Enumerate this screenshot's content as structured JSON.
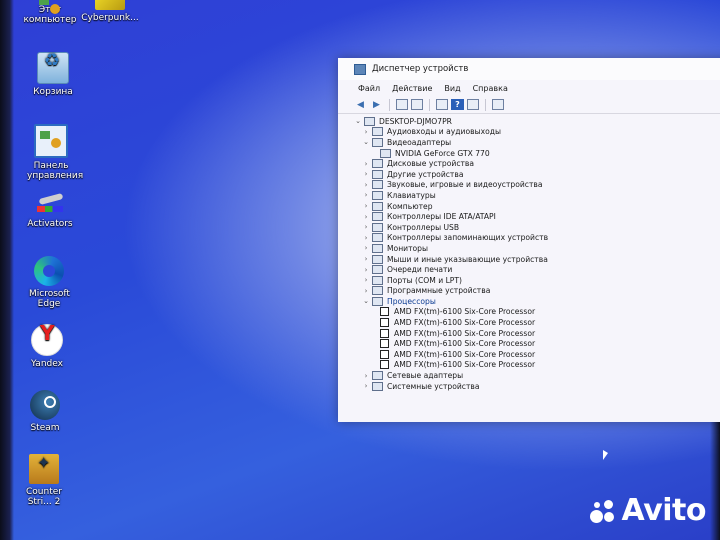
{
  "desktop": {
    "icons": [
      {
        "label": "Этот компьютер",
        "icon": "computer-icon"
      },
      {
        "label": "Cyberpunk...",
        "icon": "cyberpunk-icon"
      },
      {
        "label": "Корзина",
        "icon": "recycle-bin-icon"
      },
      {
        "label": "Панель управления",
        "icon": "control-panel-icon"
      },
      {
        "label": "Activators",
        "icon": "activators-icon"
      },
      {
        "label": "Microsoft Edge",
        "icon": "edge-icon"
      },
      {
        "label": "Yandex",
        "icon": "yandex-icon"
      },
      {
        "label": "Steam",
        "icon": "steam-icon"
      },
      {
        "label": "Counter Stri... 2",
        "icon": "counter-strike-icon"
      }
    ]
  },
  "window": {
    "title": "Диспетчер устройств",
    "menu": [
      "Файл",
      "Действие",
      "Вид",
      "Справка"
    ],
    "tree": {
      "root": "DESKTOP-DJMO7PR",
      "items": [
        {
          "label": "Аудиовходы и аудиовыходы",
          "level": 1,
          "expanded": false
        },
        {
          "label": "Видеоадаптеры",
          "level": 1,
          "expanded": true
        },
        {
          "label": "NVIDIA GeForce GTX 770",
          "level": 2
        },
        {
          "label": "Дисковые устройства",
          "level": 1,
          "expanded": false
        },
        {
          "label": "Другие устройства",
          "level": 1,
          "expanded": false
        },
        {
          "label": "Звуковые, игровые и видеоустройства",
          "level": 1,
          "expanded": false
        },
        {
          "label": "Клавиатуры",
          "level": 1,
          "expanded": false
        },
        {
          "label": "Компьютер",
          "level": 1,
          "expanded": false
        },
        {
          "label": "Контроллеры IDE ATA/ATAPI",
          "level": 1,
          "expanded": false
        },
        {
          "label": "Контроллеры USB",
          "level": 1,
          "expanded": false
        },
        {
          "label": "Контроллеры запоминающих устройств",
          "level": 1,
          "expanded": false
        },
        {
          "label": "Мониторы",
          "level": 1,
          "expanded": false
        },
        {
          "label": "Мыши и иные указывающие устройства",
          "level": 1,
          "expanded": false
        },
        {
          "label": "Очереди печати",
          "level": 1,
          "expanded": false
        },
        {
          "label": "Порты (COM и LPT)",
          "level": 1,
          "expanded": false
        },
        {
          "label": "Программные устройства",
          "level": 1,
          "expanded": false
        },
        {
          "label": "Процессоры",
          "level": 1,
          "expanded": true,
          "highlight": true
        },
        {
          "label": "AMD FX(tm)-6100 Six-Core Processor",
          "level": 2,
          "cpu": true
        },
        {
          "label": "AMD FX(tm)-6100 Six-Core Processor",
          "level": 2,
          "cpu": true
        },
        {
          "label": "AMD FX(tm)-6100 Six-Core Processor",
          "level": 2,
          "cpu": true
        },
        {
          "label": "AMD FX(tm)-6100 Six-Core Processor",
          "level": 2,
          "cpu": true
        },
        {
          "label": "AMD FX(tm)-6100 Six-Core Processor",
          "level": 2,
          "cpu": true
        },
        {
          "label": "AMD FX(tm)-6100 Six-Core Processor",
          "level": 2,
          "cpu": true
        },
        {
          "label": "Сетевые адаптеры",
          "level": 1,
          "expanded": false
        },
        {
          "label": "Системные устройства",
          "level": 1,
          "expanded": false
        }
      ]
    }
  },
  "watermark": {
    "text": "Avito"
  },
  "colors": {
    "desktop_blue": "#2f48d8",
    "selected_text": "#0d3d94"
  }
}
